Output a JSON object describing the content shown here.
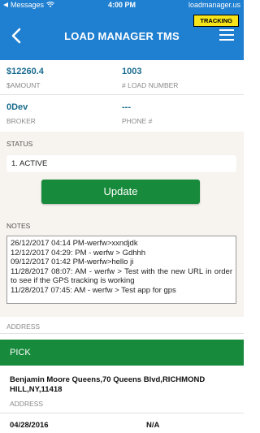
{
  "status_bar": {
    "carrier": "Messages",
    "time": "4:00 PM",
    "url": "loadmanager.us"
  },
  "header": {
    "title": "LOAD MANAGER TMS",
    "tracking_badge": "TRACKING",
    "back_icon": "chevron-left-icon",
    "menu_icon": "hamburger-menu-icon"
  },
  "info": {
    "amount_value": "$12260.4",
    "amount_label": "$AMOUNT",
    "load_number_value": "1003",
    "load_number_label": "# LOAD NUMBER",
    "broker_value": "0Dev",
    "broker_label": "BROKER",
    "phone_value": "---",
    "phone_label": "PHONE #"
  },
  "status": {
    "label": "STATUS",
    "selected": "1. ACTIVE",
    "update_label": "Update"
  },
  "notes": {
    "label": "NOTES",
    "lines": [
      "26/12/2017 04:14 PM-werfw>xxndjdk",
      "12/12/2017 04:29: PM - werfw > Gdhhh",
      "09/12/2017 01:42 PM-werfw>hello ji",
      "11/28/2017 08:07: AM - werfw > Test with the new URL in order to see if the GPS tracking is working",
      "11/28/2017 07:45: AM - werfw > Test app for gps"
    ]
  },
  "address_label": "ADDRESS",
  "pick": {
    "title": "PICK",
    "address": "Benjamin Moore Queens,70 Queens Blvd,RICHMOND HILL,NY,11418",
    "address_label": "ADDRESS",
    "date": "04/28/2016",
    "extra": "N/A"
  },
  "colors": {
    "header_blue": "#1f7fd0",
    "action_green": "#178a3b",
    "value_blue": "#1a6c8f",
    "badge_yellow": "#f7e51a",
    "section_beige": "#f7f3ee"
  }
}
